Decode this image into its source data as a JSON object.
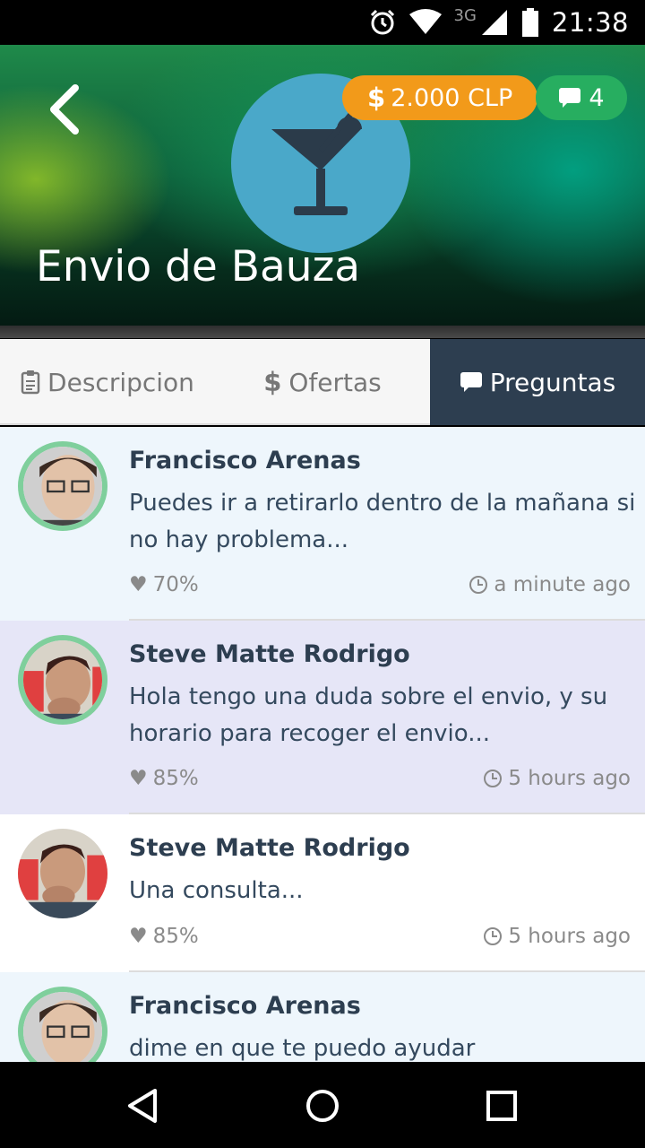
{
  "status_bar": {
    "time": "21:38",
    "network": "3G",
    "icons": [
      "alarm-icon",
      "wifi-icon",
      "signal-icon",
      "battery-icon"
    ]
  },
  "header": {
    "title": "Envio de Bauza",
    "category_icon": "cocktail-icon",
    "price": "2.000 CLP",
    "price_symbol": "$",
    "message_count": "4",
    "colors": {
      "price_badge": "#f29a1a",
      "message_badge": "#27ae60",
      "category_circle": "#4aa8c9"
    }
  },
  "tabs": [
    {
      "label": "Descripcion",
      "icon": "clipboard-icon",
      "active": false
    },
    {
      "label": "Ofertas",
      "icon": "dollar-icon",
      "active": false
    },
    {
      "label": "Preguntas",
      "icon": "comment-icon",
      "active": true
    }
  ],
  "questions": [
    {
      "author": "Francisco Arenas",
      "text": "Puedes ir a retirarlo dentro de la mañana si no hay problema...",
      "rating": "70%",
      "time": "a minute ago",
      "highlight": "#eef6fc"
    },
    {
      "author": "Steve Matte Rodrigo",
      "text": "Hola tengo una duda sobre el envio, y su horario para recoger el envio...",
      "rating": "85%",
      "time": "5 hours ago",
      "highlight": "#e6e6f7"
    },
    {
      "author": "Steve Matte Rodrigo",
      "text": "Una consulta...",
      "rating": "85%",
      "time": "5 hours ago",
      "highlight": "#ffffff"
    },
    {
      "author": "Francisco Arenas",
      "text": "dime en que te puedo ayudar",
      "rating": "",
      "time": "",
      "highlight": "#eef6fc"
    }
  ],
  "nav": [
    "back-triangle-icon",
    "home-circle-icon",
    "recents-square-icon"
  ],
  "colors": {
    "tab_active": "#2d3e50",
    "timeline": "#a9d7ee",
    "avatar_ring": "#7fcf9c"
  }
}
